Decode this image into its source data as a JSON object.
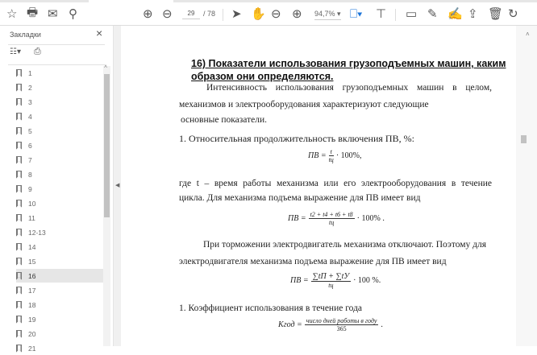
{
  "toolbar": {
    "page_current": "29",
    "page_total": "/ 78",
    "zoom": "94,7%",
    "icons": [
      "star-icon",
      "print-icon",
      "mail-icon",
      "search-icon",
      "page-up-icon",
      "page-down-icon",
      "select-icon",
      "hand-icon",
      "zoom-out-icon",
      "zoom-in-icon",
      "fit-page-icon",
      "scroll-mode-icon",
      "comment-icon",
      "highlight-icon",
      "sign-icon",
      "share-icon",
      "delete-icon",
      "rotate-icon"
    ]
  },
  "sidebar": {
    "title": "Закладки",
    "bookmarks": [
      "1",
      "2",
      "3",
      "4",
      "5",
      "6",
      "7",
      "8",
      "9",
      "10",
      "11",
      "12-13",
      "14",
      "15",
      "16",
      "17",
      "18",
      "19",
      "20",
      "21"
    ],
    "selected": "16"
  },
  "document": {
    "heading1": "16) Показатели использования грузоподъемных машин, каким",
    "heading2": "образом они определяются.",
    "p1a": "Интенсивность использования грузоподъемных машин в целом,",
    "p1b": "механизмов и электрооборудования характеризуют следующие",
    "p1c": "основные показатели.",
    "item1": "1. Относительная продолжительность включения  ПВ,  %:",
    "f1_lhs": "ПВ =",
    "f1_num": "t",
    "f1_den": "tц",
    "f1_rhs": "· 100%,",
    "p2a": "где t – время работы механизма или его электрооборудования в течение",
    "p2b": "цикла. Для механизма подъема выражение для ПВ имеет вид",
    "f2_lhs": "ПВ =",
    "f2_num": "t2 + t4 + t6 + t8",
    "f2_den": "tц",
    "f2_rhs": "· 100%  .",
    "p3a": "При торможении электродвигатель механизма отключают. Поэтому для",
    "p3b": "электродвигателя механизма подъема выражение для ПВ имеет вид",
    "f3_lhs": "ПВ =",
    "f3_num": "∑tП + ∑tУ",
    "f3_den": "tц",
    "f3_rhs": "· 100 %.",
    "item2": "1.  Коэффициент использования в течение года",
    "f4_lhs": "Kгод =",
    "f4_num": "число дней работы в году",
    "f4_den": "365",
    "f4_rhs": "."
  }
}
